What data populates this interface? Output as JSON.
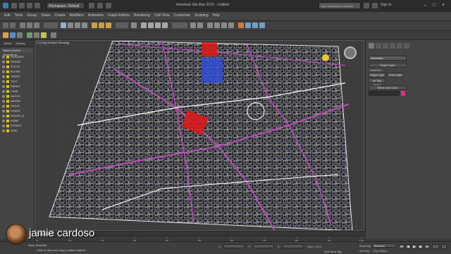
{
  "app": {
    "title": "Autodesk 3ds Max 2016 - Untitled",
    "workspace": "Workspace: Default",
    "search_placeholder": "Type a keyword or phrase",
    "sign_in": "Sign In",
    "window_controls": [
      "–",
      "□",
      "×"
    ]
  },
  "menu": {
    "items": [
      "Edit",
      "Tools",
      "Group",
      "Views",
      "Create",
      "Modifiers",
      "Animation",
      "Graph Editors",
      "Rendering",
      "Civil View",
      "Customize",
      "Scripting",
      "Help"
    ]
  },
  "scene_explorer": {
    "tabs": [
      "Select",
      "Display"
    ],
    "header": "Name (Sorted Ascending)",
    "items": [
      "BUILDING",
      "ROADS",
      "PLOTS",
      "BLDNG",
      "TREES",
      "TEXT",
      "PARKS",
      "LAND",
      "HATCH",
      "WATER",
      "PATHS",
      "FENCE",
      "ROADS_E",
      "KERB",
      "STREET",
      "GRID"
    ]
  },
  "viewport": {
    "label": "[+] [Top] [Default Shading]",
    "colors": {
      "background": "#3c3c3c",
      "grid": "#4a4a4a",
      "map_lines": "#e8e8ee",
      "roads": "#b84dba",
      "vegetation": "#c9c438",
      "highlight_red": "#e01818",
      "highlight_blue": "#2f4fe0"
    }
  },
  "command_panel": {
    "category": "Geometry",
    "rollout_object_type": "Object Type",
    "autogrid": "AutoGrid",
    "buttons": [
      "Target Light",
      "Free Light",
      "mr Sky Portal"
    ],
    "rollout_name_color": "Name and Color",
    "object_color": "#d63384"
  },
  "timeline": {
    "slider": "0 / 100",
    "ticks": [
      "0",
      "10",
      "20",
      "30",
      "40",
      "50",
      "60",
      "70",
      "80",
      "90",
      "100"
    ]
  },
  "status": {
    "selection": "None Selected",
    "prompt": "Click or click-and-drag to select objects",
    "x_label": "X:",
    "y_label": "Y:",
    "z_label": "Z:",
    "grid": "Grid = 10.0",
    "add_time_tag": "Add Time Tag",
    "auto_key": "Auto Key",
    "selected": "Selected",
    "set_key": "Set Key",
    "key_filters": "Key Filters..."
  },
  "watermark": {
    "author": "jamie cardoso"
  }
}
